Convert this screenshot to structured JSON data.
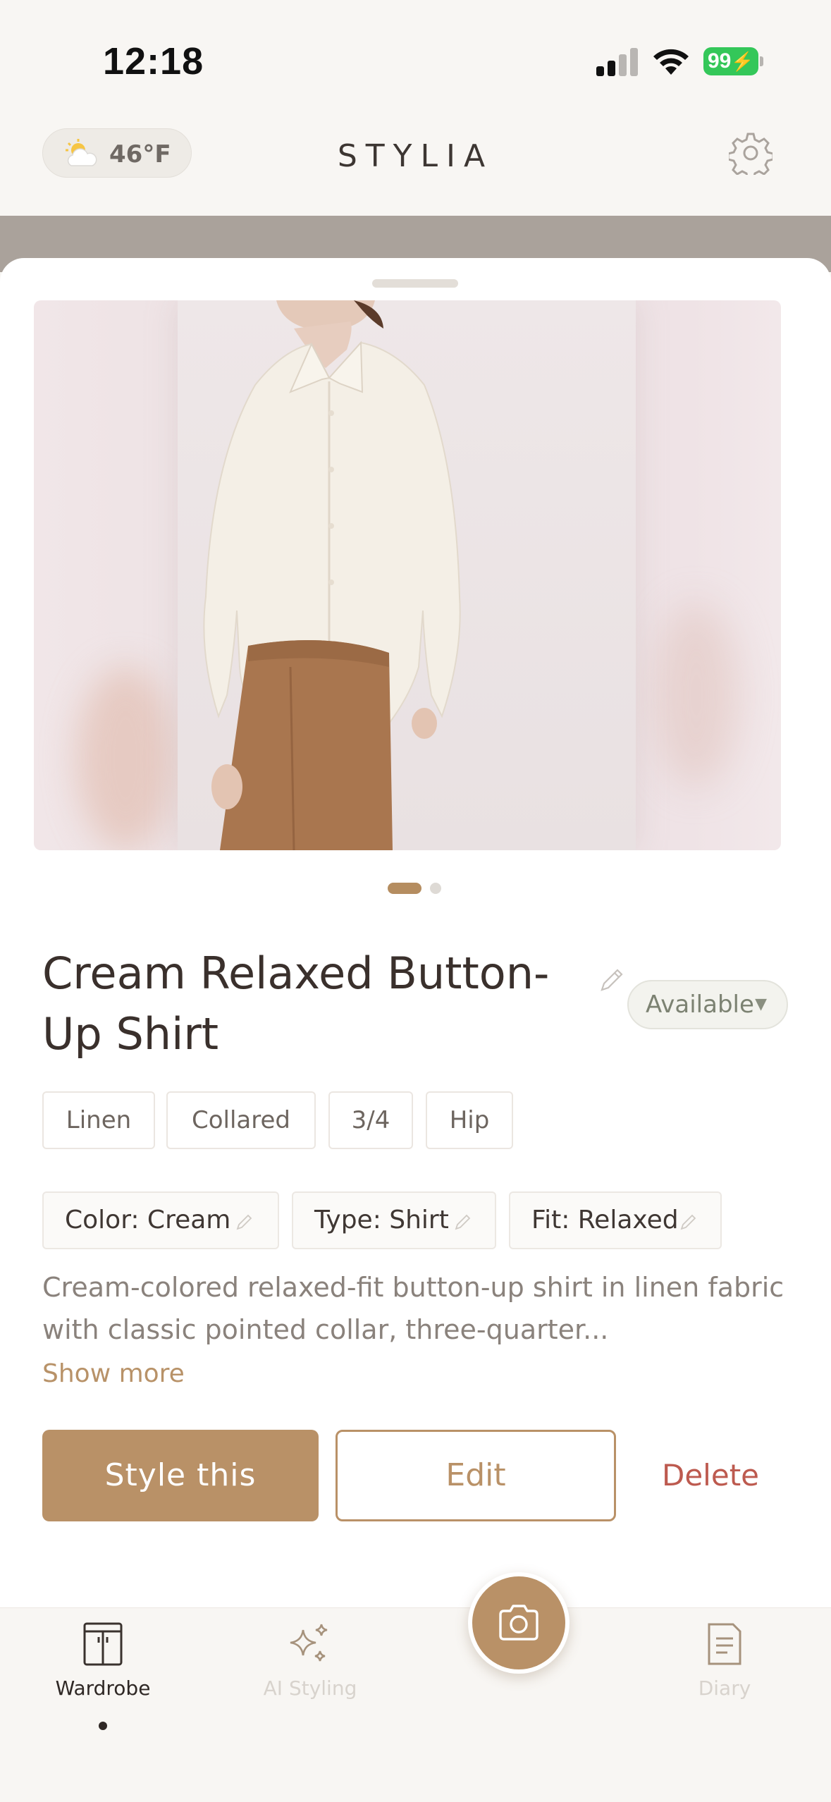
{
  "status_bar": {
    "time": "12:18",
    "battery": "99"
  },
  "header": {
    "weather_icon": "partly-cloudy-icon",
    "temperature": "46°F",
    "brand": "STYLIA",
    "settings_icon": "gear-icon"
  },
  "item": {
    "title": "Cream Relaxed Button-Up Shirt",
    "status": "Available",
    "carousel": {
      "count": 2,
      "active_index": 1
    },
    "tags": [
      "Linen",
      "Collared",
      "3/4",
      "Hip"
    ],
    "attributes": [
      {
        "label": "Color: Cream"
      },
      {
        "label": "Type: Shirt"
      },
      {
        "label": "Fit: Relaxed"
      }
    ],
    "description": "Cream-colored relaxed-fit button-up shirt in linen fabric with classic pointed collar, three-quarter...",
    "show_more": "Show more"
  },
  "actions": {
    "style": "Style this",
    "edit": "Edit",
    "delete": "Delete"
  },
  "tabbar": {
    "wardrobe": "Wardrobe",
    "ai_styling": "AI Styling",
    "diary": "Diary",
    "active": "Wardrobe"
  },
  "colors": {
    "accent": "#b99167",
    "delete": "#bd5a4f",
    "battery": "#34c759"
  }
}
